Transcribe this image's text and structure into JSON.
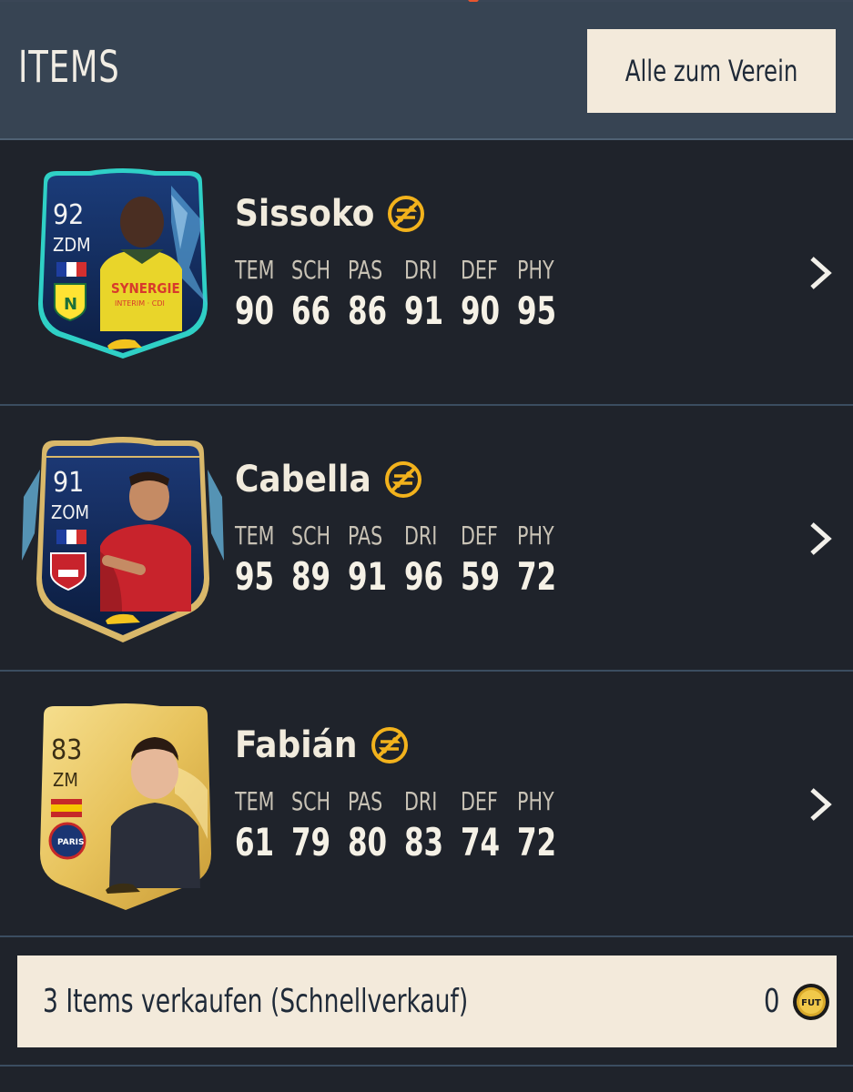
{
  "header": {
    "title": "ITEMS",
    "send_all_button": "Alle zum Verein"
  },
  "stat_labels": [
    "TEM",
    "SCH",
    "PAS",
    "DRI",
    "DEF",
    "PHY"
  ],
  "items": [
    {
      "name": "Sissoko",
      "rating": "92",
      "position": "ZDM",
      "card_text": "SYNERGIE",
      "card_subtext": "INTERIM · CDI",
      "stats": [
        "90",
        "66",
        "86",
        "91",
        "90",
        "95"
      ]
    },
    {
      "name": "Cabella",
      "rating": "91",
      "position": "ZOM",
      "card_text": "",
      "card_subtext": "",
      "stats": [
        "95",
        "89",
        "91",
        "96",
        "59",
        "72"
      ]
    },
    {
      "name": "Fabián",
      "rating": "83",
      "position": "ZM",
      "card_text": "",
      "card_subtext": "",
      "stats": [
        "61",
        "79",
        "80",
        "83",
        "74",
        "72"
      ]
    }
  ],
  "quick_sell": {
    "label": "3 Items verkaufen (Schnellverkauf)",
    "value": "0",
    "coin_label": "FUT"
  },
  "colors": {
    "accent": "#f3eadb",
    "untradeable": "#f2b21c",
    "header_bg": "#374453"
  }
}
